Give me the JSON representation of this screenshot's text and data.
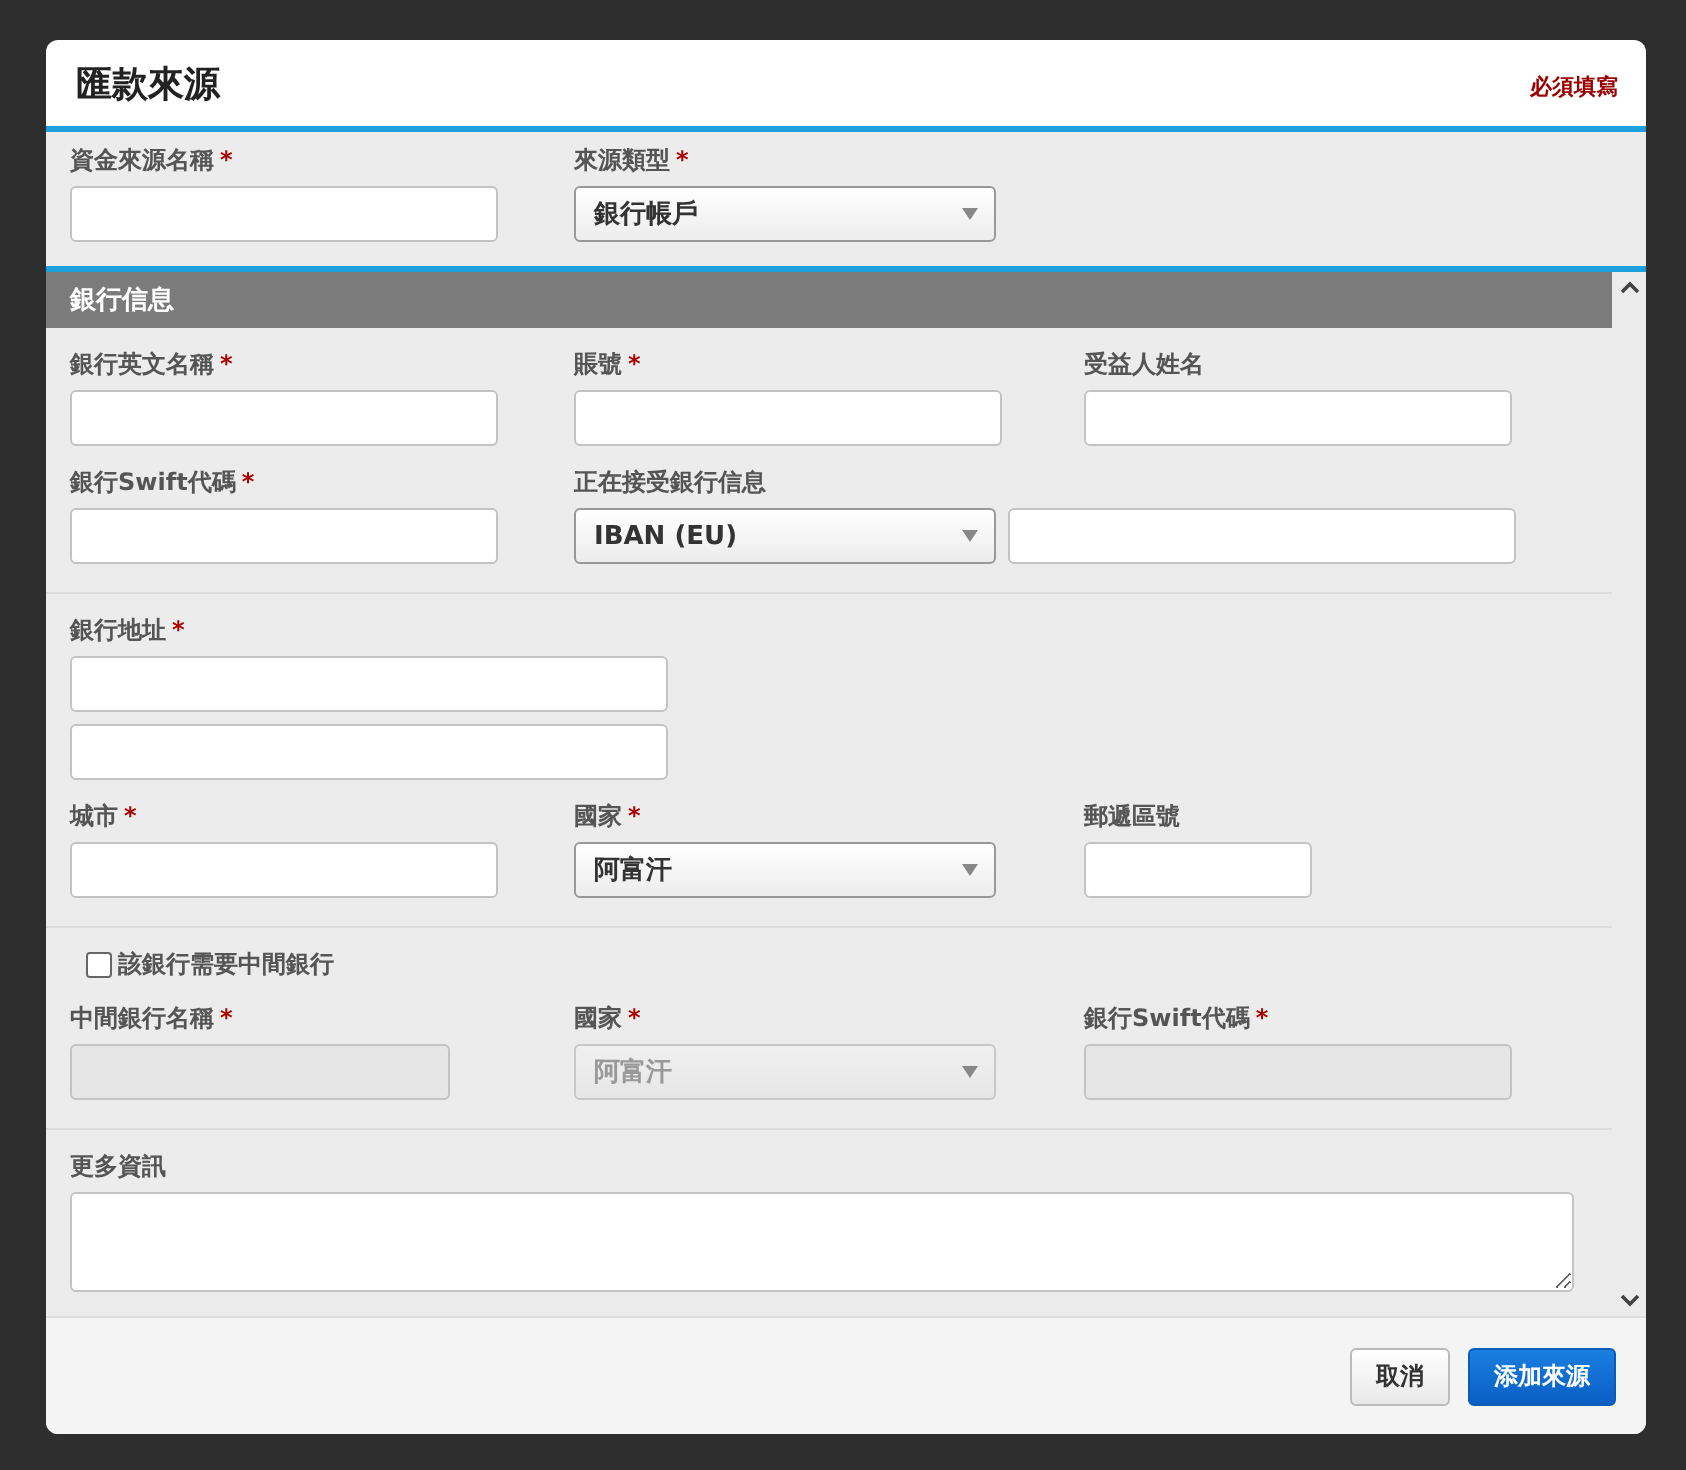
{
  "dialog": {
    "title": "匯款來源",
    "required_note": "必須填寫"
  },
  "source_fields": [
    {
      "label": "資金來源名稱",
      "mark": "*",
      "kind": "text"
    },
    {
      "label": "來源類型",
      "mark": "*",
      "kind": "select",
      "value": "銀行帳戶"
    }
  ],
  "section": {
    "title": "銀行信息"
  },
  "groups": [
    {
      "rows": [
        [
          {
            "label": "銀行英文名稱",
            "mark": "*",
            "kind": "text"
          },
          {
            "label": "賬號",
            "mark": "*",
            "kind": "text"
          },
          {
            "label": "受益人姓名",
            "kind": "text"
          }
        ],
        [
          {
            "label": "銀行Swift代碼",
            "mark": "*",
            "kind": "text"
          },
          {
            "label": "正在接受銀行信息",
            "kind": "select-with-input",
            "value": "IBAN (EU)"
          }
        ]
      ]
    },
    {
      "rows": [
        [
          {
            "label": "銀行地址",
            "mark": "*",
            "kind": "address"
          }
        ],
        [
          {
            "label": "城市",
            "mark": "*",
            "kind": "text"
          },
          {
            "label": "國家",
            "mark": "*",
            "kind": "select",
            "value": "阿富汗"
          },
          {
            "label": "郵遞區號",
            "kind": "short-text"
          }
        ]
      ]
    },
    {
      "checkbox": {
        "label": "該銀行需要中間銀行",
        "checked": false
      },
      "rows": [
        [
          {
            "label": "中間銀行名稱",
            "mark": "*",
            "kind": "narrow-text",
            "disabled": true
          },
          {
            "label": "國家",
            "mark": "*",
            "kind": "select",
            "value": "阿富汗",
            "disabled": true
          },
          {
            "label": "銀行Swift代碼",
            "mark": "*",
            "kind": "text",
            "disabled": true
          }
        ]
      ]
    },
    {
      "rows": [
        [
          {
            "label": "更多資訊",
            "kind": "textarea"
          }
        ]
      ]
    }
  ],
  "buttons": [
    {
      "label": "取消",
      "kind": "secondary"
    },
    {
      "label": "添加來源",
      "kind": "primary"
    }
  ]
}
